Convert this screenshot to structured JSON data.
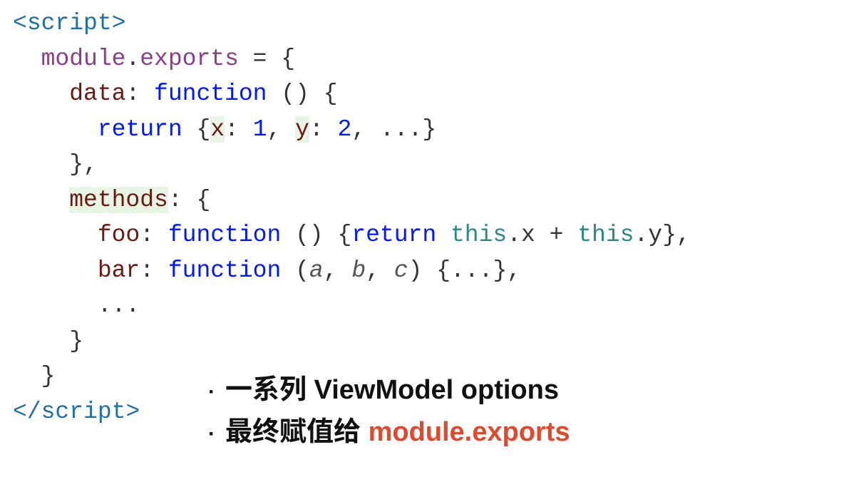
{
  "code": {
    "line1": {
      "open": "<",
      "tagName": "script",
      "close": ">"
    },
    "line2": {
      "indent": "  ",
      "module": "module",
      "dot": ".",
      "exports": "exports",
      "eq": " = ",
      "lbrace": "{"
    },
    "line3": {
      "indent": "    ",
      "key": "data",
      "colon": ": ",
      "func": "function",
      "parens": " () ",
      "lbrace": "{"
    },
    "line4": {
      "indent": "      ",
      "kw": "return",
      "sp": " ",
      "lbrace": "{",
      "xKey": "x",
      "xColon": ": ",
      "xVal": "1",
      "comma1": ", ",
      "yKey": "y",
      "yColon": ": ",
      "yVal": "2",
      "comma2": ", ",
      "dots": "...",
      "rbrace": "}"
    },
    "line5": {
      "indent": "    ",
      "rbrace": "}",
      "comma": ","
    },
    "line6": {
      "indent": "    ",
      "key": "methods",
      "colon": ": ",
      "lbrace": "{"
    },
    "line7": {
      "indent": "      ",
      "key": "foo",
      "colon": ": ",
      "func": "function",
      "parens": " () ",
      "lbrace": "{",
      "ret": "return",
      "sp": " ",
      "this1": "this",
      "dot1": ".",
      "x": "x",
      "plus": " + ",
      "this2": "this",
      "dot2": ".",
      "y": "y",
      "rbrace": "}",
      "comma": ","
    },
    "line8": {
      "indent": "      ",
      "key": "bar",
      "colon": ": ",
      "func": "function",
      "sp": " ",
      "lparen": "(",
      "a": "a",
      "c1": ", ",
      "b": "b",
      "c2": ", ",
      "c": "c",
      "rparen": ")",
      "sp2": " ",
      "lbrace": "{",
      "dots": "...",
      "rbrace": "}",
      "comma": ","
    },
    "line9": {
      "indent": "      ",
      "dots": "..."
    },
    "line10": {
      "indent": "    ",
      "rbrace": "}"
    },
    "line11": {
      "indent": "  ",
      "rbrace": "}"
    },
    "line12": {
      "open": "</",
      "tagName": "script",
      "close": ">"
    }
  },
  "bullets": {
    "b1": "一系列 ViewModel options",
    "b2_prefix": "最终赋值给 ",
    "b2_hl": "module.exports"
  }
}
